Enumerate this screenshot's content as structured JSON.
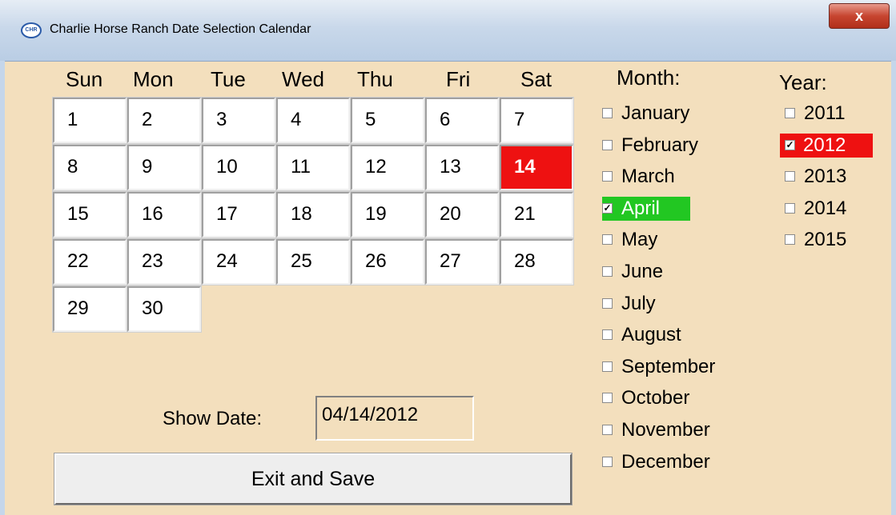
{
  "window": {
    "title": "Charlie Horse Ranch Date Selection Calendar",
    "icon_text": "CHR",
    "close_label": "x"
  },
  "calendar": {
    "day_headers": [
      "Sun",
      "Mon",
      "Tue",
      "Wed",
      "Thu",
      "Fri",
      "Sat"
    ],
    "days": [
      "1",
      "2",
      "3",
      "4",
      "5",
      "6",
      "7",
      "8",
      "9",
      "10",
      "11",
      "12",
      "13",
      "14",
      "15",
      "16",
      "17",
      "18",
      "19",
      "20",
      "21",
      "22",
      "23",
      "24",
      "25",
      "26",
      "27",
      "28",
      "29",
      "30"
    ],
    "selected_day": "14",
    "selected_color": "#ee1111"
  },
  "months": {
    "header": "Month:",
    "items": [
      "January",
      "February",
      "March",
      "April",
      "May",
      "June",
      "July",
      "August",
      "September",
      "October",
      "November",
      "December"
    ],
    "selected": "April",
    "selected_color": "#22c722"
  },
  "years": {
    "header": "Year:",
    "items": [
      "2011",
      "2012",
      "2013",
      "2014",
      "2015"
    ],
    "selected": "2012",
    "selected_color": "#ee1111"
  },
  "show_date": {
    "label": "Show Date:",
    "value": "04/14/2012"
  },
  "exit_button": {
    "label": "Exit and Save"
  },
  "colors": {
    "background": "#f3dfbd",
    "titlebar": "#c9d8ea"
  }
}
